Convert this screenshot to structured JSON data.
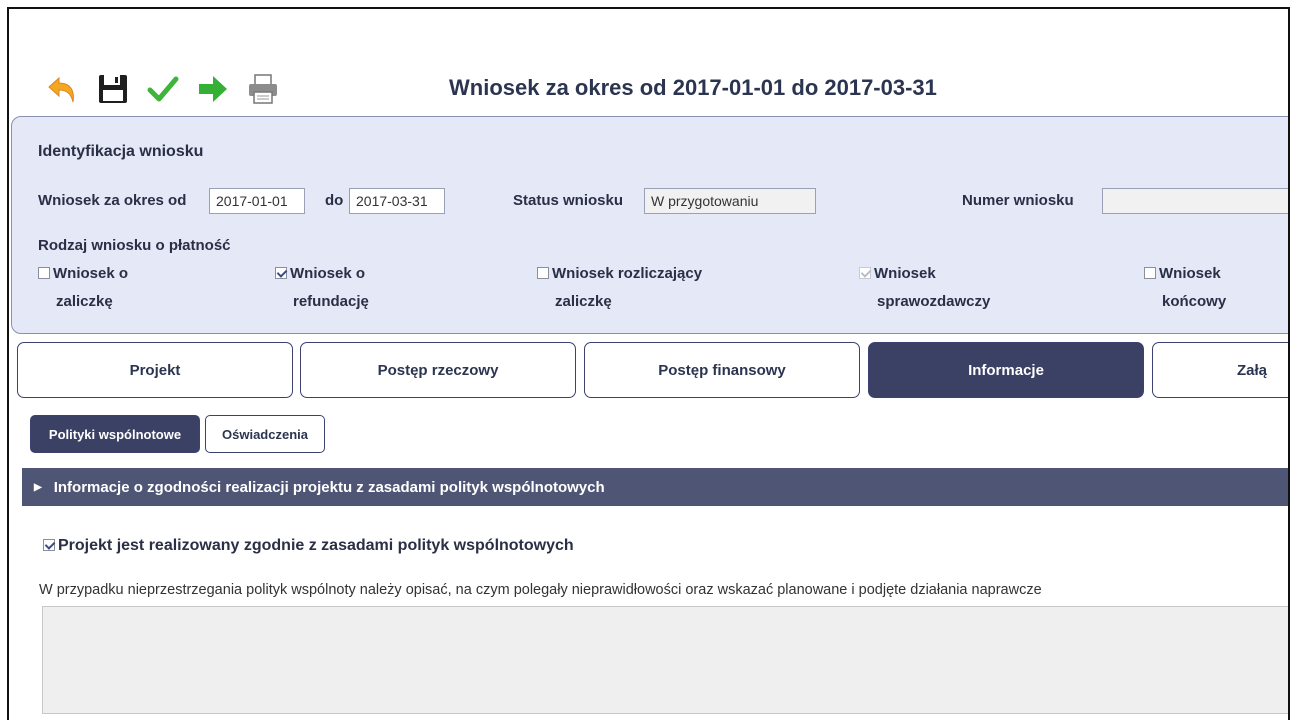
{
  "header": {
    "title": "Wniosek za okres od 2017-01-01 do 2017-03-31"
  },
  "toolbar": {
    "icons": [
      "undo-arrow-icon",
      "save-floppy-icon",
      "validate-check-icon",
      "forward-arrow-icon",
      "print-icon"
    ]
  },
  "identification": {
    "heading": "Identyfikacja wniosku",
    "period_label": "Wniosek za okres od",
    "period_from": "2017-01-01",
    "to_label": "do",
    "period_to": "2017-03-31",
    "status_label": "Status wniosku",
    "status_value": "W przygotowaniu",
    "number_label": "Numer wniosku",
    "number_value": "",
    "kind_label": "Rodzaj wniosku o płatność",
    "kinds": [
      {
        "line1": "Wniosek o",
        "line2": "zaliczkę",
        "checked": false,
        "disabled": false
      },
      {
        "line1": "Wniosek o",
        "line2": "refundację",
        "checked": true,
        "disabled": false
      },
      {
        "line1": "Wniosek rozliczający",
        "line2": "zaliczkę",
        "checked": false,
        "disabled": false
      },
      {
        "line1": "Wniosek",
        "line2": "sprawozdawczy",
        "checked": true,
        "disabled": true
      },
      {
        "line1": "Wniosek",
        "line2": "końcowy",
        "checked": false,
        "disabled": false
      }
    ]
  },
  "tabs": [
    {
      "label": "Projekt",
      "active": false
    },
    {
      "label": "Postęp rzeczowy",
      "active": false
    },
    {
      "label": "Postęp finansowy",
      "active": false
    },
    {
      "label": "Informacje",
      "active": true
    },
    {
      "label": "Załą",
      "active": false
    }
  ],
  "subtabs": [
    {
      "label": "Polityki wspólnotowe",
      "active": true
    },
    {
      "label": "Oświadczenia",
      "active": false
    }
  ],
  "section": {
    "title": "Informacje o zgodności realizacji projektu z zasadami polityk wspólnotowych",
    "compliance_label": "Projekt jest realizowany zgodnie z zasadami polityk wspólnotowych",
    "compliance_checked": true,
    "description": "W przypadku nieprzestrzegania polityk wspólnoty należy opisać, na czym polegały nieprawidłowości oraz wskazać planowane i podjęte działania naprawcze",
    "textarea_value": ""
  },
  "colors": {
    "accent": "#3b4065",
    "panel_bg": "#e4e8f7",
    "section_bar": "#4f5575"
  }
}
